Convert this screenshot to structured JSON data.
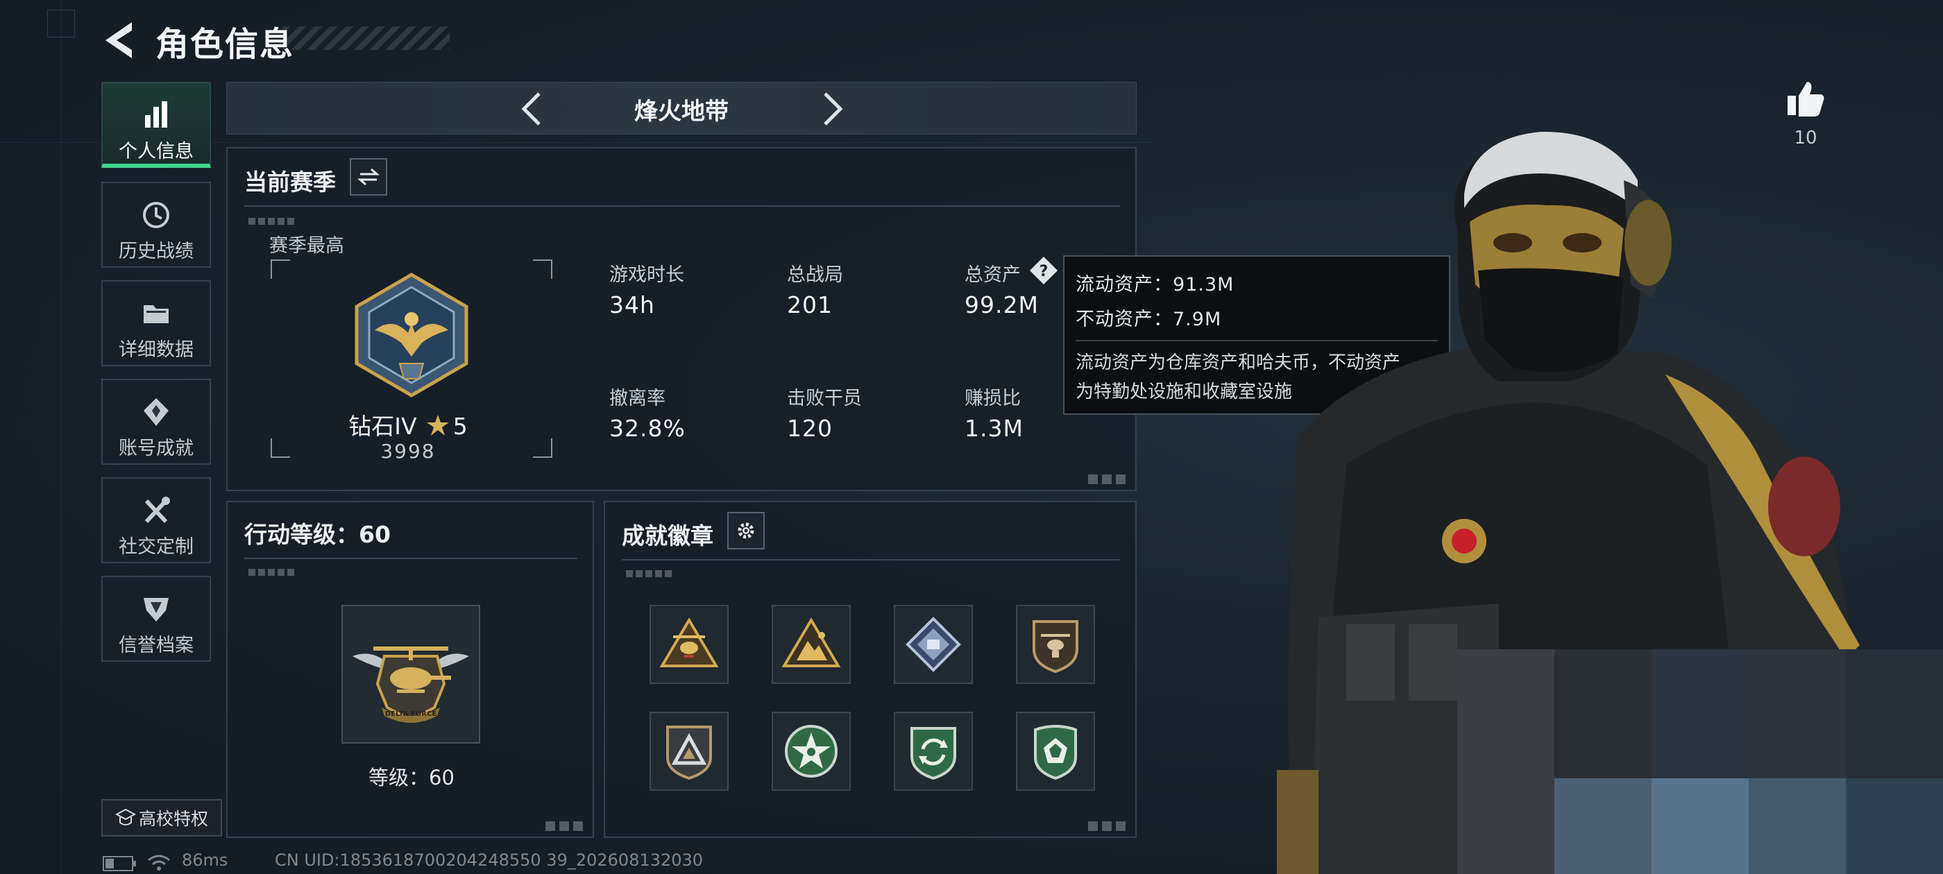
{
  "header": {
    "title": "角色信息"
  },
  "sidebar": {
    "items": [
      {
        "label": "个人信息",
        "active": true,
        "icon": "bar-chart-icon"
      },
      {
        "label": "历史战绩",
        "active": false,
        "icon": "history-icon"
      },
      {
        "label": "详细数据",
        "active": false,
        "icon": "folder-icon"
      },
      {
        "label": "账号成就",
        "active": false,
        "icon": "achievement-icon"
      },
      {
        "label": "社交定制",
        "active": false,
        "icon": "tools-icon"
      },
      {
        "label": "信誉档案",
        "active": false,
        "icon": "shield-icon"
      }
    ],
    "campus_label": "高校特权"
  },
  "mode": {
    "title": "烽火地带"
  },
  "season": {
    "title": "当前赛季",
    "best_label": "赛季最高",
    "rank_name": "钻石IV",
    "rank_stars": "5",
    "rank_score": "3998",
    "stats": [
      {
        "label": "游戏时长",
        "value": "34h"
      },
      {
        "label": "总战局",
        "value": "201"
      },
      {
        "label": "总资产",
        "value": "99.2M"
      },
      {
        "label": "撤离率",
        "value": "32.8%"
      },
      {
        "label": "击败干员",
        "value": "120"
      },
      {
        "label": "赚损比",
        "value": "1.3M"
      }
    ]
  },
  "tooltip": {
    "liquid": "流动资产：91.3M",
    "fixed": "不动资产：7.9M",
    "desc_line1": "流动资产为仓库资产和哈夫币，不动资产",
    "desc_line2": "为特勤处设施和收藏室设施"
  },
  "level": {
    "title": "行动等级：60",
    "level_text": "等级：60",
    "emblem_text": "DELTA FORCE"
  },
  "badges": {
    "title": "成就徽章",
    "items": [
      {
        "icon": "helicopter-triangle-badge-icon"
      },
      {
        "icon": "mountain-triangle-badge-icon"
      },
      {
        "icon": "diamond-badge-icon"
      },
      {
        "icon": "helicopter-shield-badge-icon"
      },
      {
        "icon": "triangle-shield-badge-icon"
      },
      {
        "icon": "star-circle-badge-icon"
      },
      {
        "icon": "recycle-shield-badge-icon"
      },
      {
        "icon": "gem-shield-badge-icon"
      }
    ]
  },
  "likes": {
    "count": "10"
  },
  "status_bar": {
    "ping": "86ms",
    "uid": "CN UID:1853618700204248550 39_202608132030"
  },
  "colors": {
    "accent_green": "#3fd48c",
    "gold": "#c9a24a",
    "background": "#17202a"
  }
}
